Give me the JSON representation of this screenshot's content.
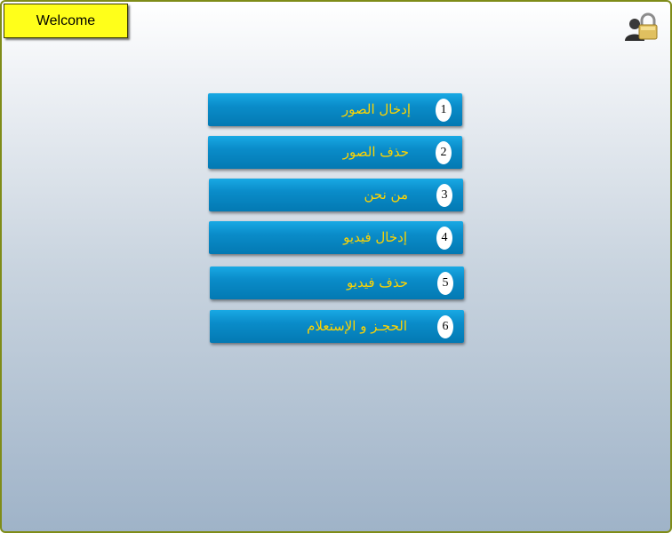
{
  "header": {
    "welcome_label": "Welcome",
    "lock_icon": "user-lock-icon"
  },
  "menu": {
    "items": [
      {
        "number": "1",
        "label": "إدخال الصور"
      },
      {
        "number": "2",
        "label": "حذف الصور"
      },
      {
        "number": "3",
        "label": "من نحن"
      },
      {
        "number": "4",
        "label": "إدخال فيديو"
      },
      {
        "number": "5",
        "label": "حذف فيديو"
      },
      {
        "number": "6",
        "label": "الحجـز و الإستعلام"
      }
    ]
  },
  "colors": {
    "frame_border": "#7f8c18",
    "welcome_bg": "#ffff1a",
    "button_blue": "#0a8cc9",
    "label_yellow": "#ffd400"
  }
}
